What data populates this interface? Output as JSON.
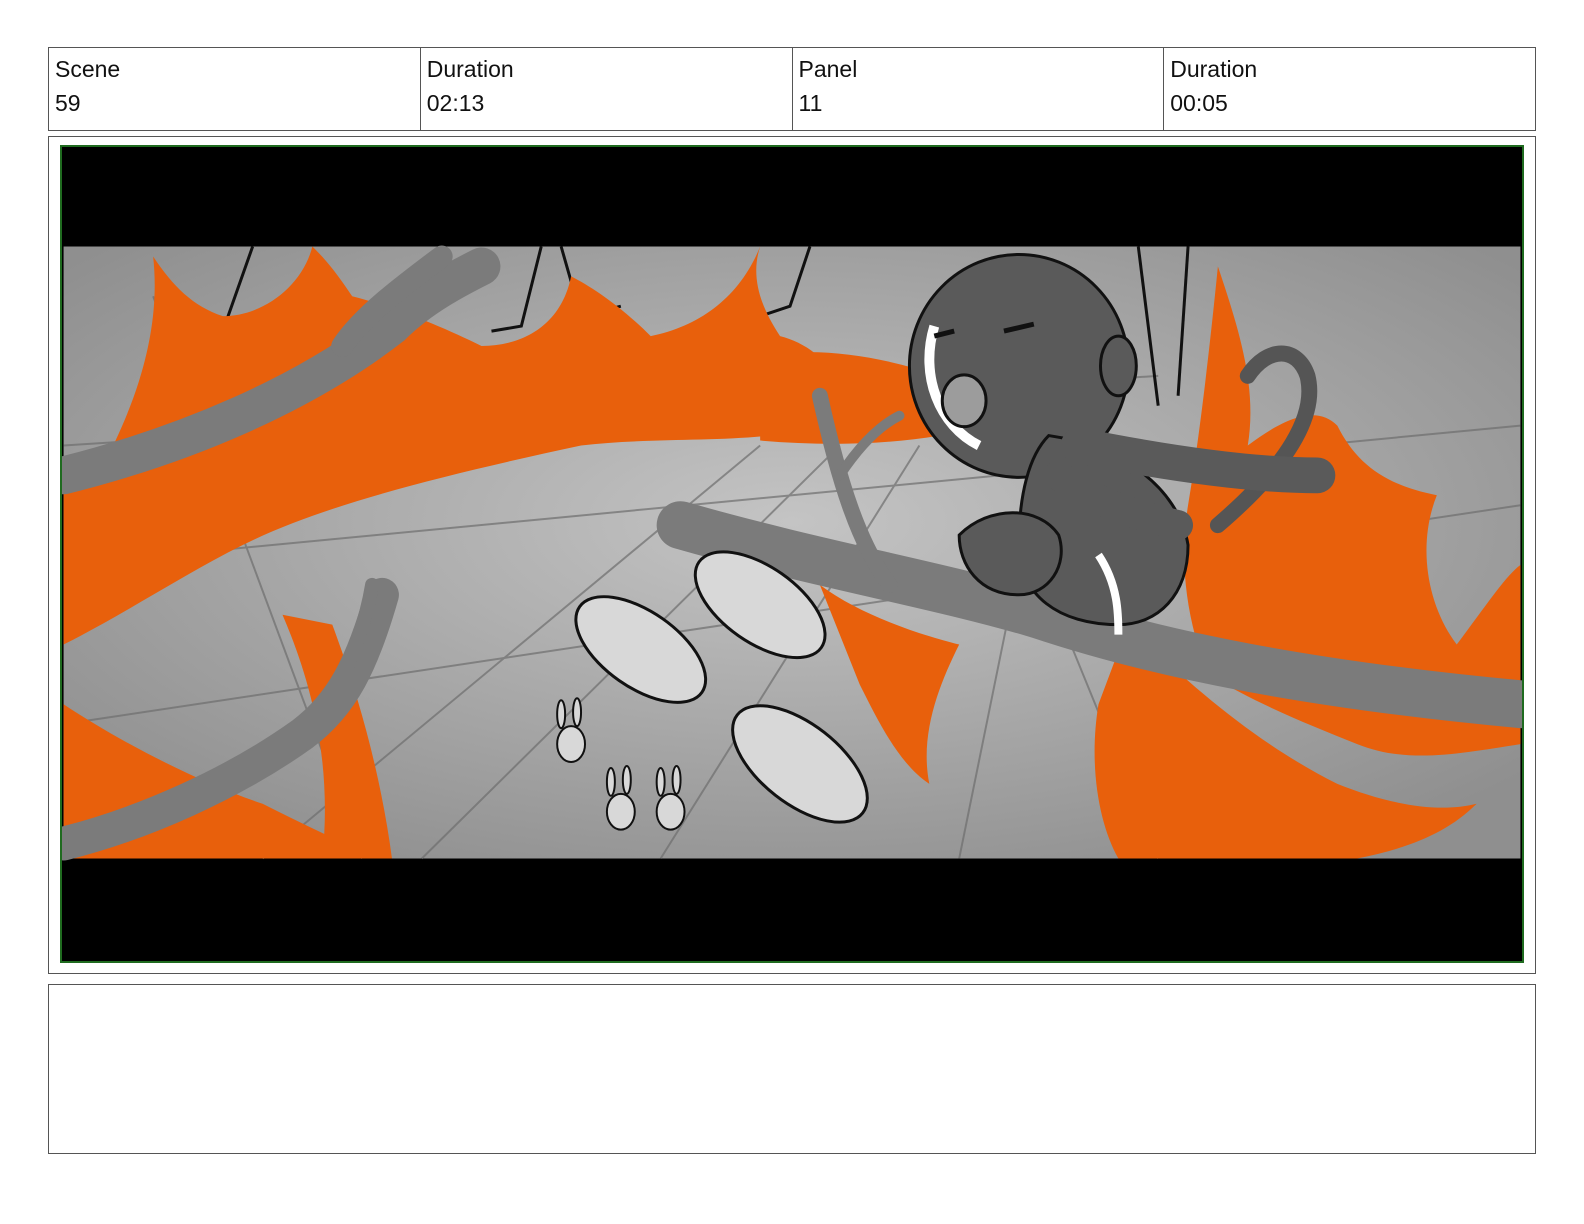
{
  "header": {
    "scene_label": "Scene",
    "scene_value": "59",
    "scene_duration_label": "Duration",
    "scene_duration_value": "02:13",
    "panel_label": "Panel",
    "panel_value": "11",
    "panel_duration_label": "Duration",
    "panel_duration_value": "00:05"
  },
  "panel": {
    "frame_border_color": "#1f6b1f",
    "palette": {
      "fire": "#e8600c",
      "ground": "#a6a6a6",
      "branch": "#7b7b7b",
      "letterbox": "#000000"
    }
  },
  "notes": {
    "text": ""
  }
}
